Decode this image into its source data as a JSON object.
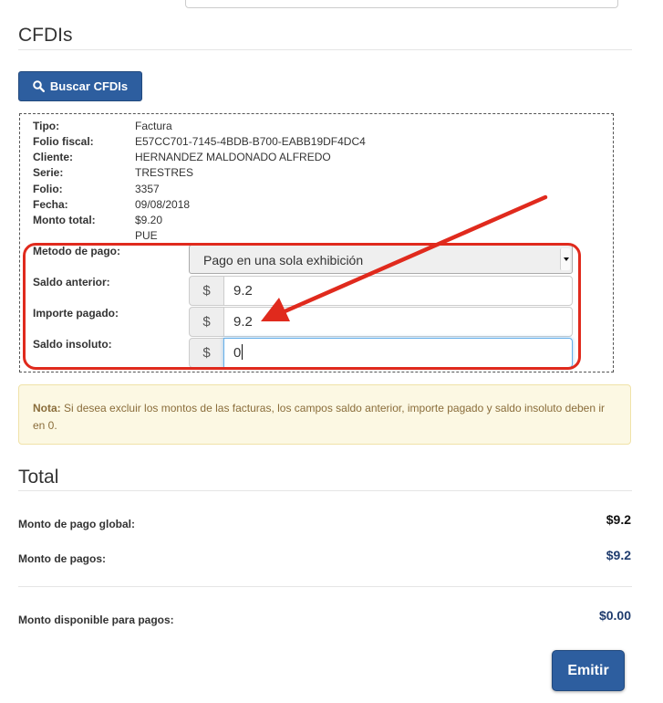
{
  "cfdis": {
    "title": "CFDIs",
    "search_button": "Buscar CFDIs",
    "info": [
      {
        "label": "Tipo:",
        "value": "Factura"
      },
      {
        "label": "Folio fiscal:",
        "value": "E57CC701-7145-4BDB-B700-EABB19DF4DC4"
      },
      {
        "label": "Cliente:",
        "value": "HERNANDEZ MALDONADO ALFREDO"
      },
      {
        "label": "Serie:",
        "value": "TRESTRES"
      },
      {
        "label": "Folio:",
        "value": "3357"
      },
      {
        "label": "Fecha:",
        "value": "09/08/2018"
      },
      {
        "label": "Monto total:",
        "value": "$9.20"
      },
      {
        "label": "",
        "value": "PUE"
      }
    ],
    "metodo_pago": {
      "label": "Metodo de pago:",
      "selected": "Pago en una sola exhibición"
    },
    "saldo_anterior": {
      "label": "Saldo anterior:",
      "currency": "$",
      "value": "9.2"
    },
    "importe_pagado": {
      "label": "Importe pagado:",
      "currency": "$",
      "value": "9.2"
    },
    "saldo_insoluto": {
      "label": "Saldo insoluto:",
      "currency": "$",
      "value": "0"
    }
  },
  "note": {
    "bold": "Nota:",
    "text": "Si desea excluir los montos de las facturas, los campos saldo anterior, importe pagado y saldo insoluto deben ir en 0."
  },
  "total": {
    "title": "Total",
    "global_label": "Monto de pago global:",
    "global_value": "$9.2",
    "pagos_label": "Monto de pagos:",
    "pagos_value": "$9.2",
    "disponible_label": "Monto disponible para pagos:",
    "disponible_value": "$0.00"
  },
  "emitir_button": "Emitir",
  "colors": {
    "primary": "#2d5e9f",
    "annotation_red": "#e02a1d",
    "note_bg": "#fcf8e3",
    "value_blue": "#1f3c6e"
  },
  "icons": {
    "search": "search-icon"
  }
}
